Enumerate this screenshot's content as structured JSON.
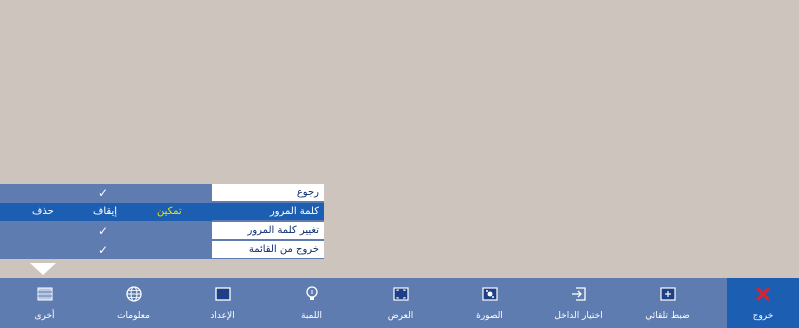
{
  "submenu": {
    "rows": [
      {
        "label": "رجوع",
        "check": "✓"
      },
      {
        "label": "كلمة المرور",
        "enable": "تمكين",
        "disable": "إيقاف",
        "delete": "حذف"
      },
      {
        "label": "تغيير كلمة المرور",
        "check": "✓"
      },
      {
        "label": "خروج من القائمة",
        "check": "✓"
      }
    ]
  },
  "bottombar": {
    "tabs": [
      {
        "label": "أخرى",
        "icon": "other-icon"
      },
      {
        "label": "معلومات",
        "icon": "globe-icon"
      },
      {
        "label": "الإعداد",
        "icon": "setup-icon"
      },
      {
        "label": "اللمبة",
        "icon": "lamp-icon"
      },
      {
        "label": "العرض",
        "icon": "display-icon"
      },
      {
        "label": "الصورة",
        "icon": "image-icon"
      },
      {
        "label": "اختيار الداخل",
        "icon": "input-select-icon"
      },
      {
        "label": "ضبط تلقائي",
        "icon": "auto-adjust-icon"
      },
      {
        "label": "خروج",
        "icon": "close-icon"
      }
    ]
  },
  "colors": {
    "background": "#cdc5bd",
    "bar": "#5f7cb0",
    "highlight": "#1c5fb2",
    "exit_x": "#e0202a",
    "enable_text": "#e6e600"
  }
}
